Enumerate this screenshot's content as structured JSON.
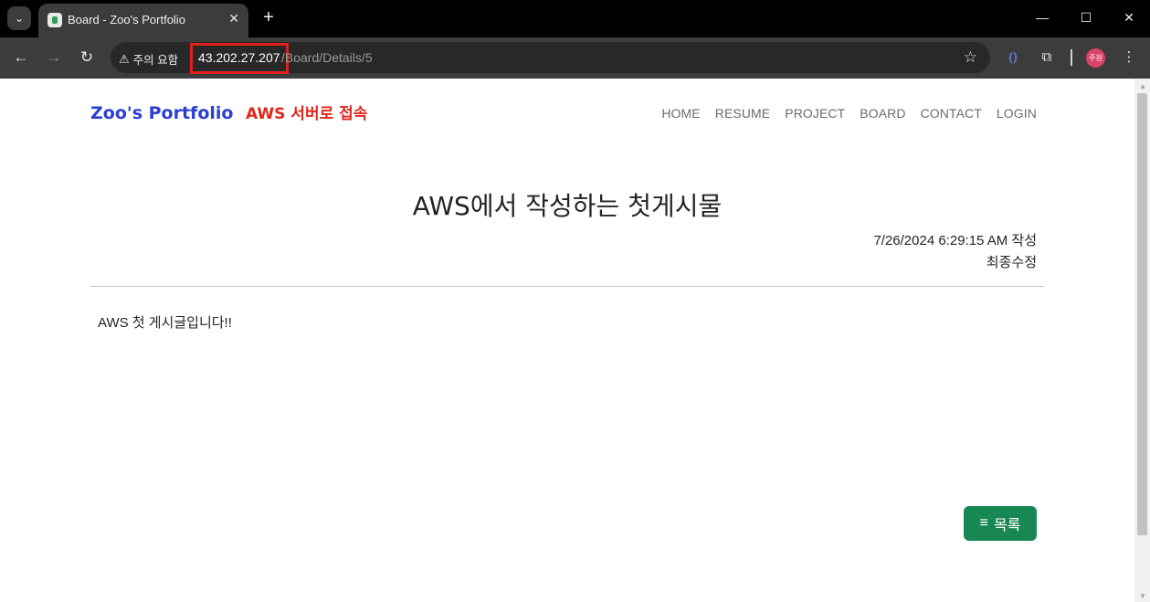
{
  "browser": {
    "tab_title": "Board - Zoo's Portfolio",
    "security_label": "주의 요함",
    "url_host": "43.202.27.207",
    "url_path": "/Board/Details/5",
    "profile_label": "주원"
  },
  "site": {
    "brand": "Zoo's Portfolio",
    "annotation": "AWS 서버로 접속",
    "nav": [
      "HOME",
      "RESUME",
      "PROJECT",
      "BOARD",
      "CONTACT",
      "LOGIN"
    ]
  },
  "post": {
    "title": "AWS에서 작성하는 첫게시물",
    "created": "7/26/2024 6:29:15 AM 작성",
    "modified": "최종수정",
    "body": "AWS 첫 게시글입니다!!"
  },
  "actions": {
    "list_label": "목록"
  },
  "colors": {
    "brand": "#2b3fd2",
    "annotation": "#e0281c",
    "list_button": "#198754",
    "highlight_box": "#e0201a"
  }
}
